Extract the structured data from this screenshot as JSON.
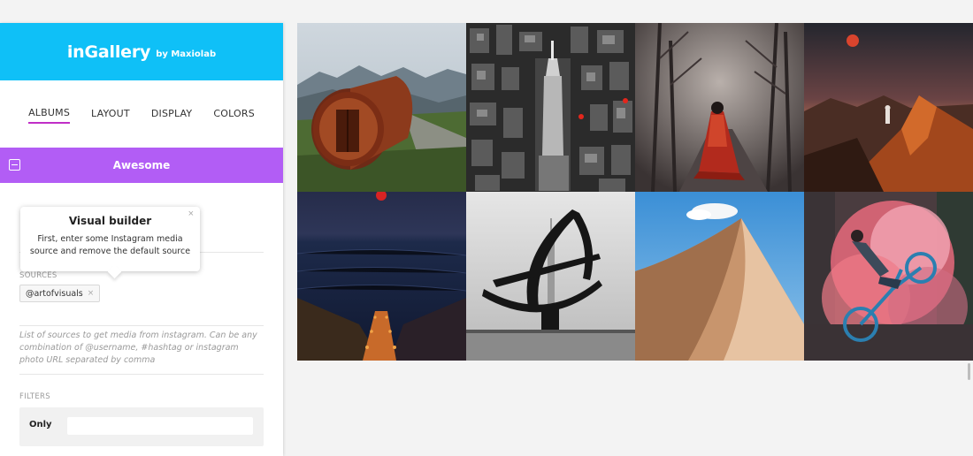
{
  "brand": {
    "name": "inGallery",
    "by": "by Maxiolab",
    "color": "#0fc0f7"
  },
  "tabs": [
    {
      "label": "ALBUMS",
      "active": true
    },
    {
      "label": "LAYOUT",
      "active": false
    },
    {
      "label": "DISPLAY",
      "active": false
    },
    {
      "label": "COLORS",
      "active": false
    }
  ],
  "album": {
    "title": "Awesome",
    "color": "#b25df5",
    "collapse_icon": "minus-square-icon"
  },
  "tooltip": {
    "title": "Visual builder",
    "text": "First, enter some Instagram media source and remove the default source",
    "close_glyph": "×"
  },
  "sources": {
    "label": "SOURCES",
    "tag": "@artofvisuals",
    "remove_glyph": "×",
    "help": "List of sources to get media from instagram. Can be any combination of @username, #hashtag or instagram photo URL separated by comma"
  },
  "filters": {
    "label": "FILTERS",
    "only_label": "Only",
    "only_value": ""
  },
  "gallery": {
    "photos": [
      {
        "name": "photo-cabin-mountains"
      },
      {
        "name": "photo-city-aerial"
      },
      {
        "name": "photo-forest-red-cloak"
      },
      {
        "name": "photo-mountain-moon"
      },
      {
        "name": "photo-sea-stairs-night"
      },
      {
        "name": "photo-sculpture-skyline"
      },
      {
        "name": "photo-desert-dune"
      },
      {
        "name": "photo-bike-smoke"
      }
    ]
  }
}
